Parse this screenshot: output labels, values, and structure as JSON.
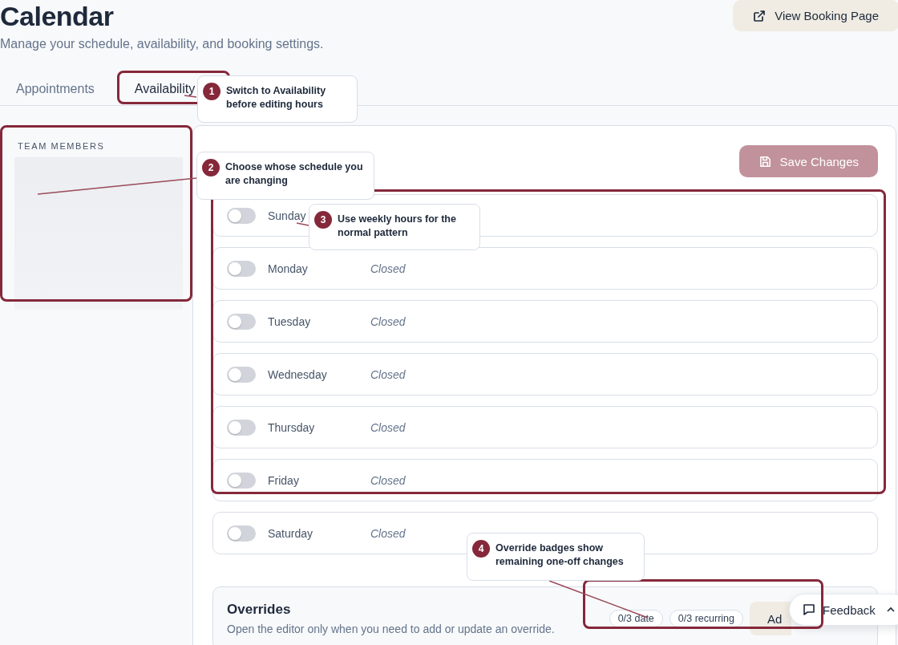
{
  "header": {
    "title": "Calendar",
    "subtitle": "Manage your schedule, availability, and booking settings.",
    "action": "View Booking Page"
  },
  "tabs": [
    {
      "label": "Appointments",
      "selected": false
    },
    {
      "label": "Availability",
      "selected": true
    }
  ],
  "sidebar": {
    "heading": "TEAM MEMBERS",
    "loading": true
  },
  "save_button": {
    "label": "Save Changes",
    "disabled": true
  },
  "days": [
    {
      "name": "Sunday",
      "enabled": false
    },
    {
      "name": "Monday",
      "enabled": false,
      "status": "Closed"
    },
    {
      "name": "Tuesday",
      "enabled": false,
      "status": "Closed"
    },
    {
      "name": "Wednesday",
      "enabled": false,
      "status": "Closed"
    },
    {
      "name": "Thursday",
      "enabled": false,
      "status": "Closed"
    },
    {
      "name": "Friday",
      "enabled": false,
      "status": "Closed"
    },
    {
      "name": "Saturday",
      "enabled": false,
      "status": "Closed"
    }
  ],
  "overrides": {
    "title": "Overrides",
    "description": "Open the editor only when you need to add or update an override.",
    "badges": [
      "0/3 date",
      "0/3 recurring"
    ],
    "button": "Ad"
  },
  "feedback": {
    "label": "Feedback"
  },
  "annotations": [
    {
      "number": "1",
      "text": "Switch to Availability before editing hours"
    },
    {
      "number": "2",
      "text": "Choose whose schedule you are changing"
    },
    {
      "number": "3",
      "text": "Use weekly hours for the normal pattern"
    },
    {
      "number": "4",
      "text": "Override badges show remaining one-off changes"
    }
  ]
}
